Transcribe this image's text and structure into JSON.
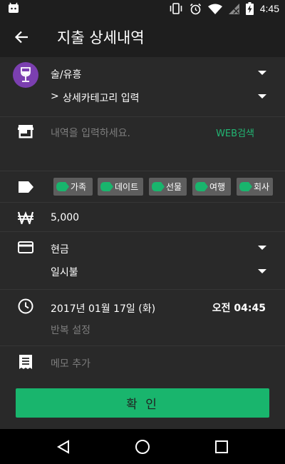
{
  "status_bar": {
    "time": "4:45"
  },
  "app_bar": {
    "title": "지출 상세내역"
  },
  "category": {
    "value": "술/유흥",
    "sub_prefix": ">",
    "sub_placeholder": "상세카테고리 입력"
  },
  "store": {
    "placeholder": "내역을 입력하세요.",
    "web_search_label": "WEB검색"
  },
  "tags": [
    {
      "label": "가족"
    },
    {
      "label": "데이트"
    },
    {
      "label": "선물"
    },
    {
      "label": "여행"
    },
    {
      "label": "회사"
    }
  ],
  "amount": {
    "value": "5,000"
  },
  "payment": {
    "method": "현금",
    "installment": "일시불"
  },
  "datetime": {
    "date": "2017년 01월 17일 (화)",
    "time": "오전 04:45",
    "repeat_label": "반복 설정"
  },
  "memo": {
    "placeholder": "메모 추가"
  },
  "confirm_label": "확 인",
  "colors": {
    "accent": "#19b56d",
    "web_search": "#22b573",
    "category_avatar": "#7b3fb0",
    "chip": "#5e5e5e"
  }
}
